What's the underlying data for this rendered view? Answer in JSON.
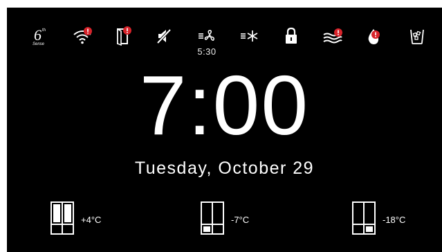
{
  "status_icons": [
    {
      "icon": "sixth-sense-logo-icon",
      "text": "6",
      "superscript": "th",
      "caption": "Sense"
    },
    {
      "icon": "wifi-alert-icon"
    },
    {
      "icon": "door-open-alert-icon"
    },
    {
      "icon": "sound-muted-icon"
    },
    {
      "icon": "fast-cool-fan-icon",
      "sub_label": "5:30"
    },
    {
      "icon": "fast-freeze-icon"
    },
    {
      "icon": "lock-icon"
    },
    {
      "icon": "water-filter-alert-icon"
    },
    {
      "icon": "water-drop-alert-icon"
    },
    {
      "icon": "ice-maker-icon"
    }
  ],
  "clock": {
    "time": "7:00",
    "date": "Tuesday, October 29"
  },
  "zones": [
    {
      "icon": "fridge-compartment-icon",
      "temperature": "+4°C"
    },
    {
      "icon": "convertible-compartment-icon",
      "temperature": "-7°C"
    },
    {
      "icon": "freezer-compartment-icon",
      "temperature": "-18°C"
    }
  ],
  "colors": {
    "background": "#000000",
    "foreground": "#ffffff",
    "alert": "#d8232a"
  }
}
